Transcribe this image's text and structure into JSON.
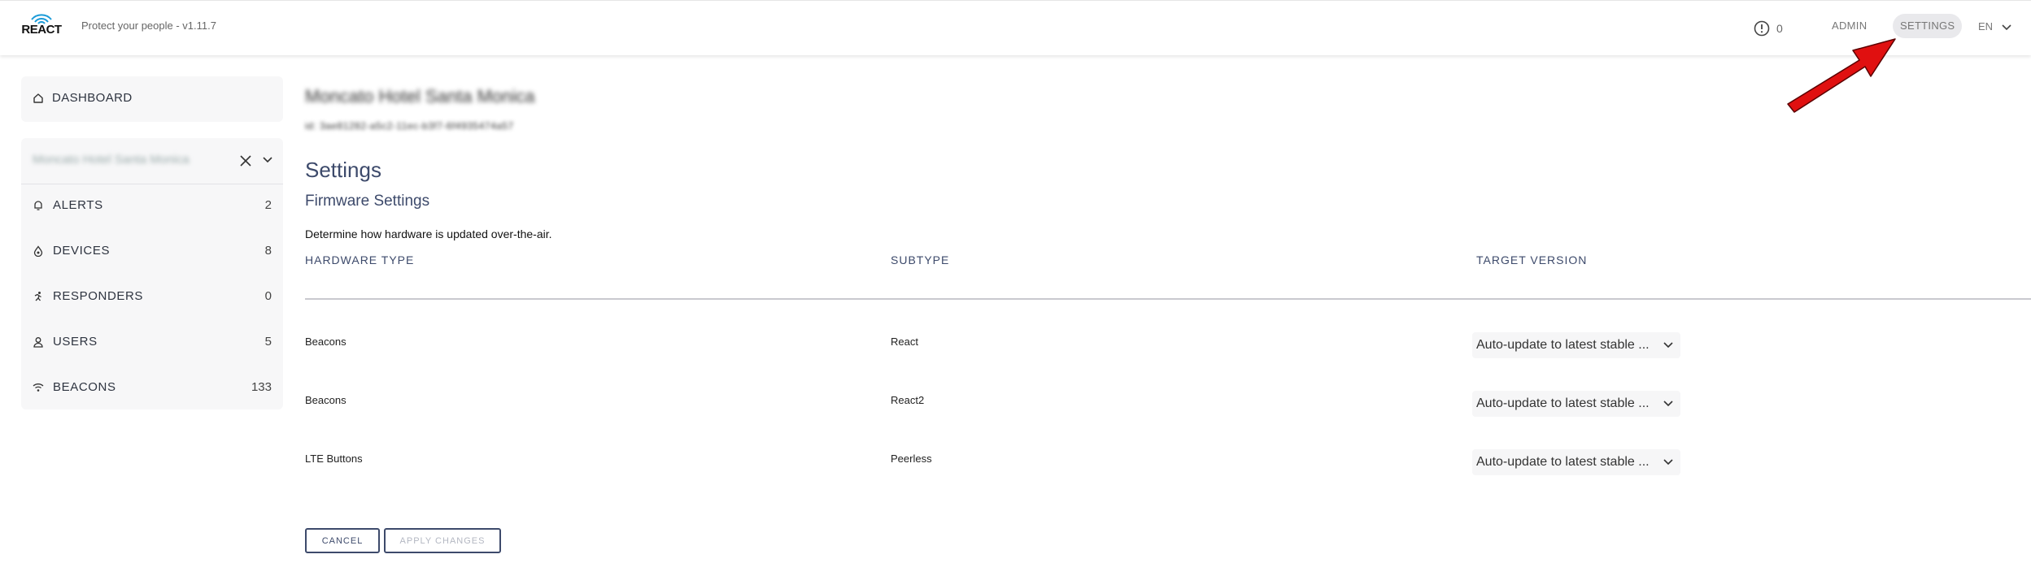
{
  "header": {
    "logo_text": "REACT",
    "tagline": "Protect your people - v1.11.7",
    "alert_count": "0",
    "nav": {
      "admin": "ADMIN",
      "settings": "SETTINGS",
      "language": "EN"
    },
    "icons": {
      "alert": "alert-circle-icon",
      "language_dropdown": "chevron-down-icon",
      "logo": "wifi-signal-icon"
    }
  },
  "sidebar": {
    "dashboard_label": "DASHBOARD",
    "site_selector": {
      "value": "Moncato Hotel Santa Monica"
    },
    "items": [
      {
        "label": "ALERTS",
        "count": "2",
        "icon": "bell-icon"
      },
      {
        "label": "DEVICES",
        "count": "8",
        "icon": "drop-icon"
      },
      {
        "label": "RESPONDERS",
        "count": "0",
        "icon": "runner-icon"
      },
      {
        "label": "USERS",
        "count": "5",
        "icon": "person-icon"
      },
      {
        "label": "BEACONS",
        "count": "133",
        "icon": "wifi-icon"
      }
    ]
  },
  "main": {
    "site_title": "Moncato Hotel Santa Monica",
    "site_id": "id: 3ae81282-a5c2-11ec-b3f7-6f4935474a57",
    "page_title": "Settings",
    "section_title": "Firmware Settings",
    "section_description": "Determine how hardware is updated over-the-air.",
    "columns": {
      "hardware_type": "HARDWARE TYPE",
      "subtype": "SUBTYPE",
      "target_version": "TARGET VERSION"
    },
    "rows": [
      {
        "hardware_type": "Beacons",
        "subtype": "React",
        "target_version": "Auto-update to latest stable ..."
      },
      {
        "hardware_type": "Beacons",
        "subtype": "React2",
        "target_version": "Auto-update to latest stable ..."
      },
      {
        "hardware_type": "LTE Buttons",
        "subtype": "Peerless",
        "target_version": "Auto-update to latest stable ..."
      }
    ],
    "buttons": {
      "cancel": "CANCEL",
      "apply": "APPLY CHANGES"
    }
  },
  "colors": {
    "accent": "#3d4a6b",
    "annotation_arrow": "#e01010"
  }
}
